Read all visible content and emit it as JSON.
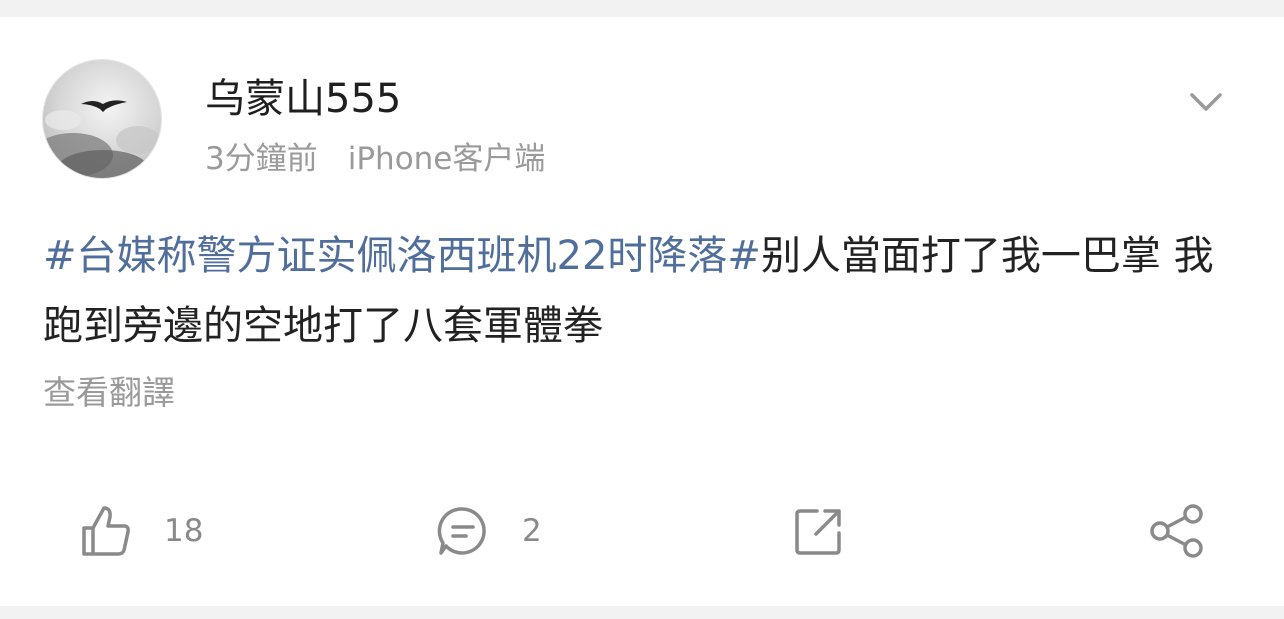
{
  "post": {
    "author": {
      "name": "乌蒙山555",
      "avatar_icon": "avatar-bird-sky"
    },
    "meta": {
      "time": "3分鐘前",
      "source": "iPhone客户端"
    },
    "menu_icon": "chevron-down-icon",
    "content": {
      "topic": "#台媒称警方证实佩洛西班机22时降落#",
      "text": "别人當面打了我一巴掌 我跑到旁邊的空地打了八套軍體拳"
    },
    "translate_label": "查看翻譯",
    "actions": {
      "like": {
        "icon": "thumbs-up-icon",
        "count": "18"
      },
      "comment": {
        "icon": "comment-icon",
        "count": "2"
      },
      "repost": {
        "icon": "repost-icon"
      },
      "share": {
        "icon": "share-icon"
      }
    }
  },
  "colors": {
    "topic_link": "#506e9b",
    "text_primary": "#222222",
    "text_secondary": "#9a9a9a",
    "icon_gray": "#8a8a8a",
    "background": "#f2f2f2"
  }
}
